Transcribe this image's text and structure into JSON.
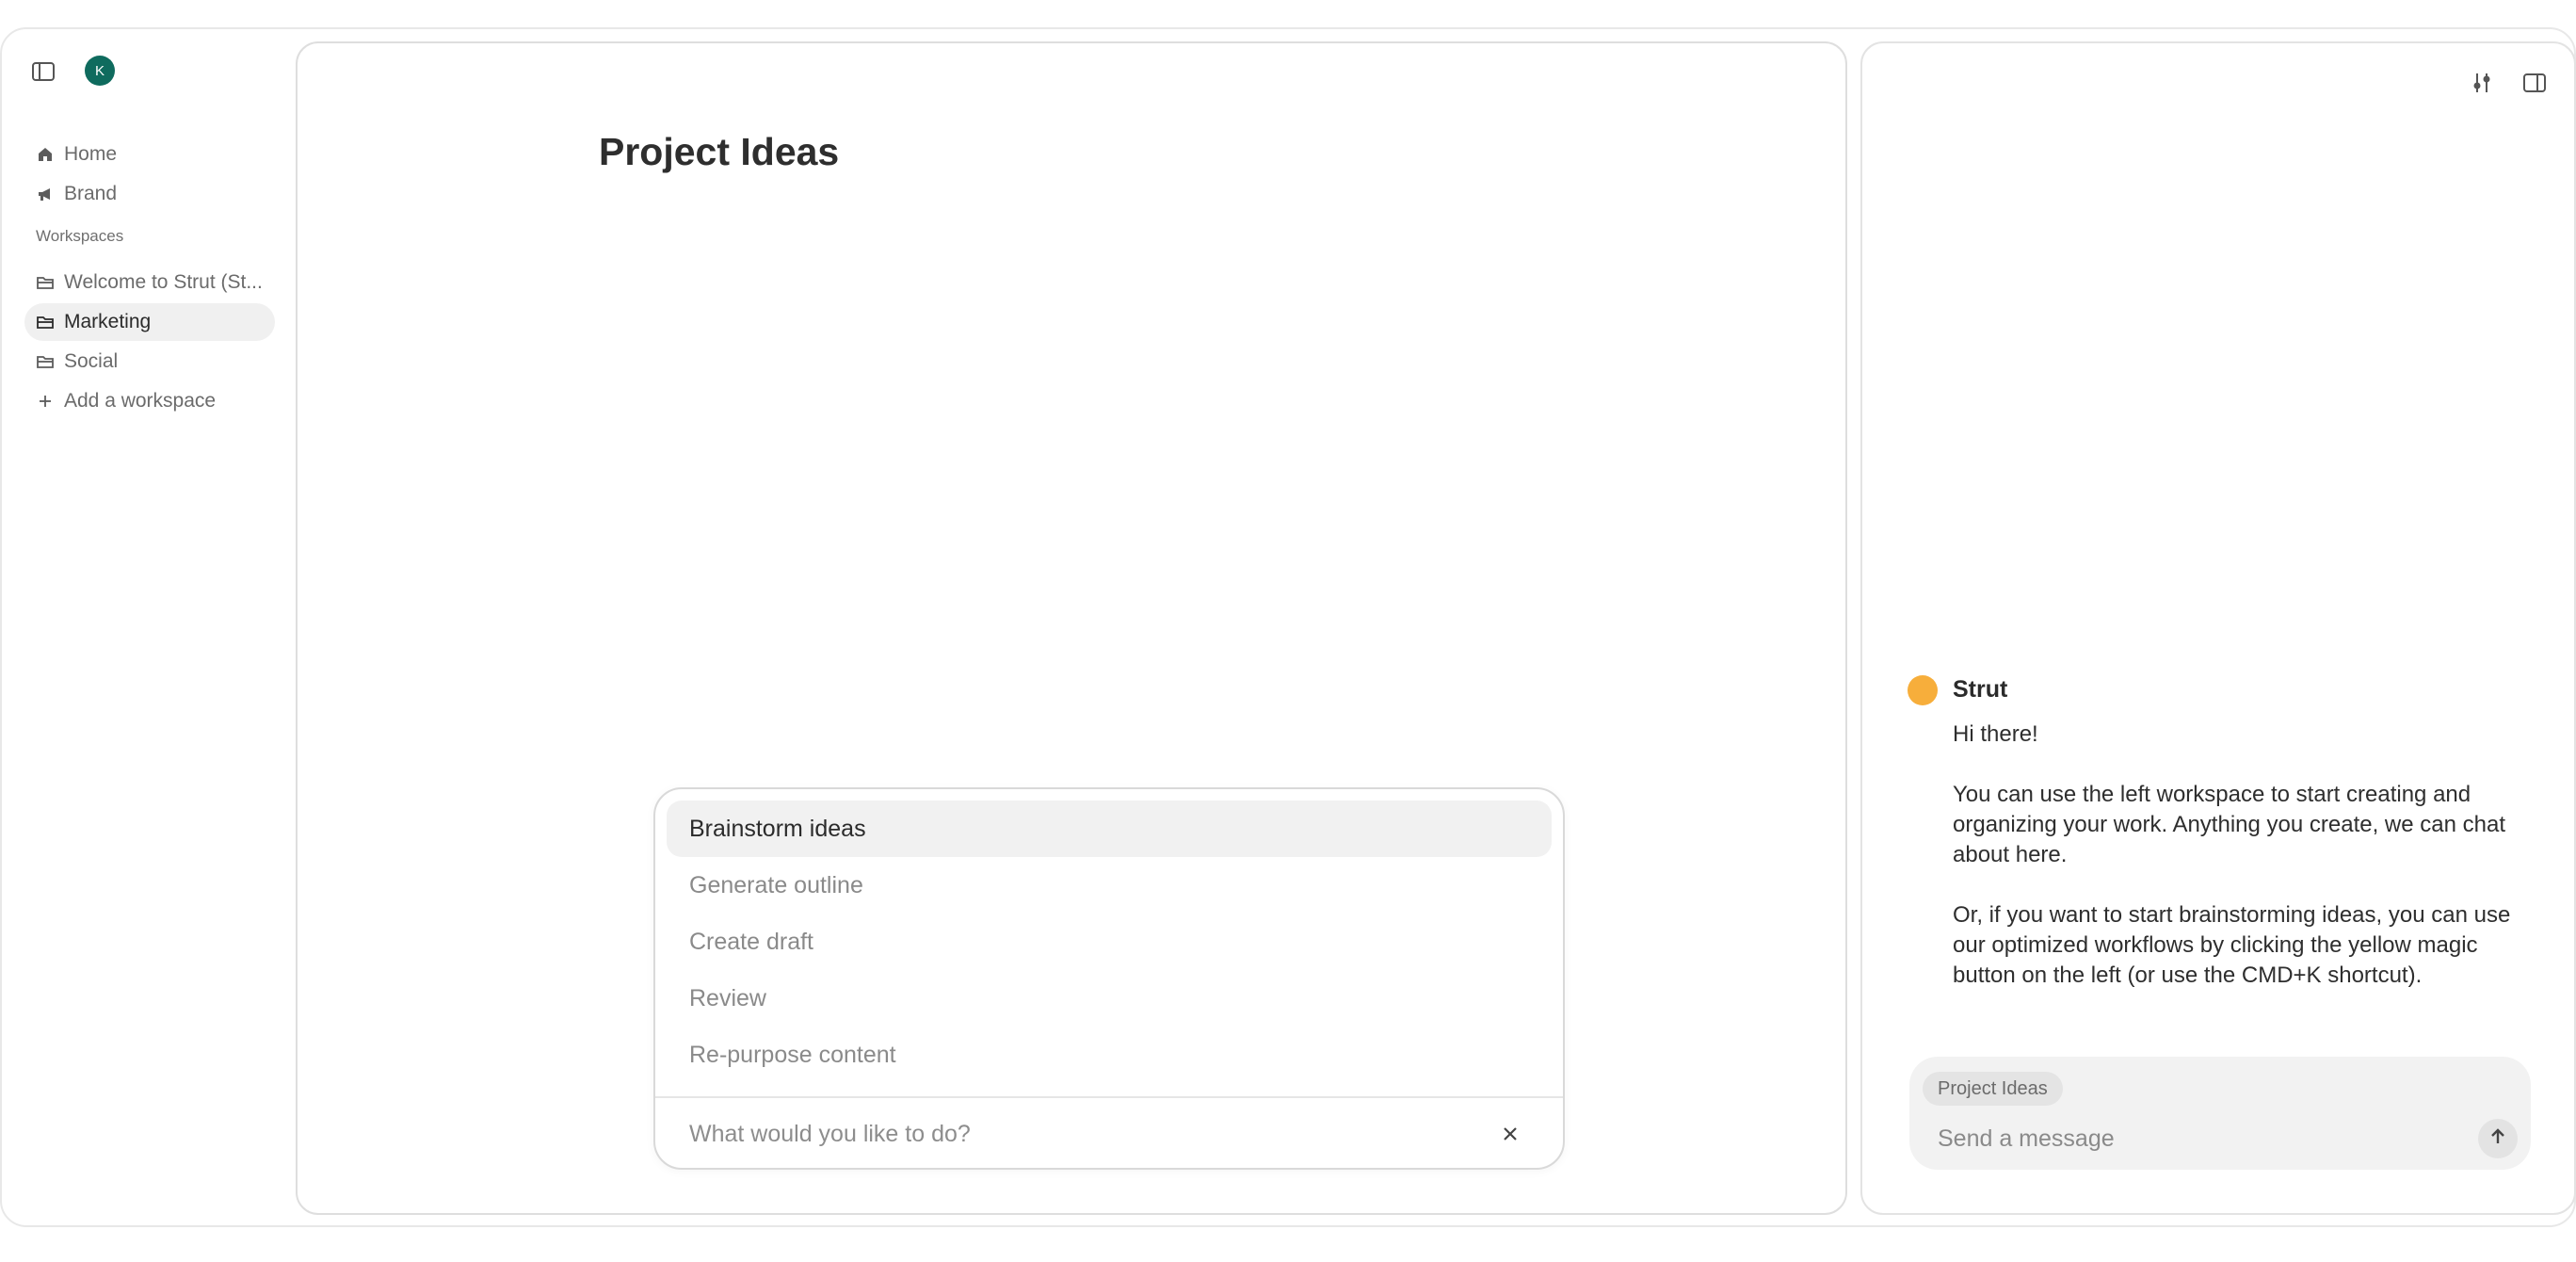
{
  "user": {
    "avatar_initial": "K"
  },
  "sidebar": {
    "nav": [
      {
        "label": "Home",
        "icon": "home-icon"
      },
      {
        "label": "Brand",
        "icon": "megaphone-icon"
      }
    ],
    "workspaces_label": "Workspaces",
    "workspaces": [
      {
        "label": "Welcome to Strut (St...",
        "icon": "folder-icon",
        "active": false
      },
      {
        "label": "Marketing",
        "icon": "folder-icon",
        "active": true
      },
      {
        "label": "Social",
        "icon": "folder-icon",
        "active": false
      }
    ],
    "add_workspace_label": "Add a workspace"
  },
  "editor": {
    "title": "Project Ideas",
    "palette": {
      "items": [
        {
          "label": "Brainstorm ideas",
          "active": true
        },
        {
          "label": "Generate outline",
          "active": false
        },
        {
          "label": "Create draft",
          "active": false
        },
        {
          "label": "Review",
          "active": false
        },
        {
          "label": "Re-purpose content",
          "active": false
        }
      ],
      "input_placeholder": "What would you like to do?"
    }
  },
  "chat": {
    "bot_name": "Strut",
    "bot_color": "#f7ae3b",
    "message_paragraphs": [
      "Hi there!",
      "You can use the left workspace to start creating and organizing your work. Anything you create, we can chat about here.",
      "Or, if you want to start brainstorming ideas, you can use our optimized workflows by clicking the yellow magic button on the left (or use the CMD+K shortcut)."
    ],
    "context_chip": "Project Ideas",
    "input_placeholder": "Send a message"
  },
  "colors": {
    "avatar_bg": "#0f6b5e",
    "active_bg": "#f0f0f0"
  }
}
